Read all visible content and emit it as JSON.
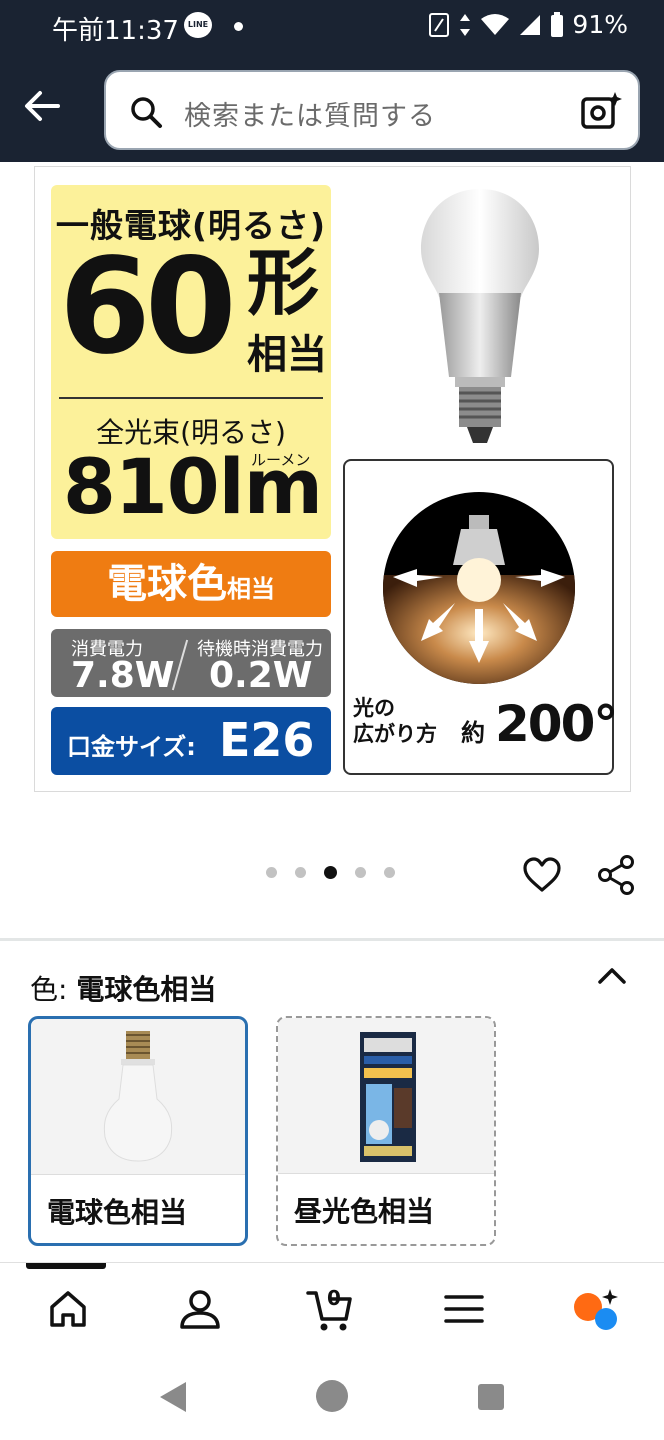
{
  "status_bar": {
    "time": "午前11:37",
    "line_app": "LINE",
    "battery": "91%"
  },
  "search": {
    "placeholder": "検索または質問する"
  },
  "product_image": {
    "general_bulb_label": "一般電球(明るさ)",
    "wattage_equiv": "60",
    "wattage_unit": "形",
    "equivalent": "相当",
    "luminous_flux_label": "全光束(明るさ)",
    "lumen_ruby": "ルーメン",
    "lumens": "810lm",
    "light_color": "電球色",
    "light_color_suffix": "相当",
    "power_label": "消費電力",
    "power_value": "7.8W",
    "standby_label": "待機時消費電力",
    "standby_value": "0.2W",
    "base_label": "口金サイズ:",
    "base_value": "E26",
    "spread_label_line1": "光の",
    "spread_label_line2": "広がり方",
    "spread_approx": "約",
    "spread_value": "200°"
  },
  "carousel": {
    "total": 5,
    "active_index": 2
  },
  "variation": {
    "label": "色:",
    "selected": "電球色相当",
    "options": [
      {
        "label": "電球色相当",
        "selected": true
      },
      {
        "label": "昼光色相当",
        "selected": false
      }
    ]
  },
  "bottom_nav": {
    "cart_count": "0",
    "items": [
      "home",
      "account",
      "cart",
      "menu",
      "rufus"
    ]
  },
  "colors": {
    "header_bg": "#1a2332",
    "yellow": "#fcf19a",
    "orange": "#ef7c12",
    "gray": "#6c6c6c",
    "blue": "#0b4ea2",
    "selected_border": "#2a6fb0"
  }
}
